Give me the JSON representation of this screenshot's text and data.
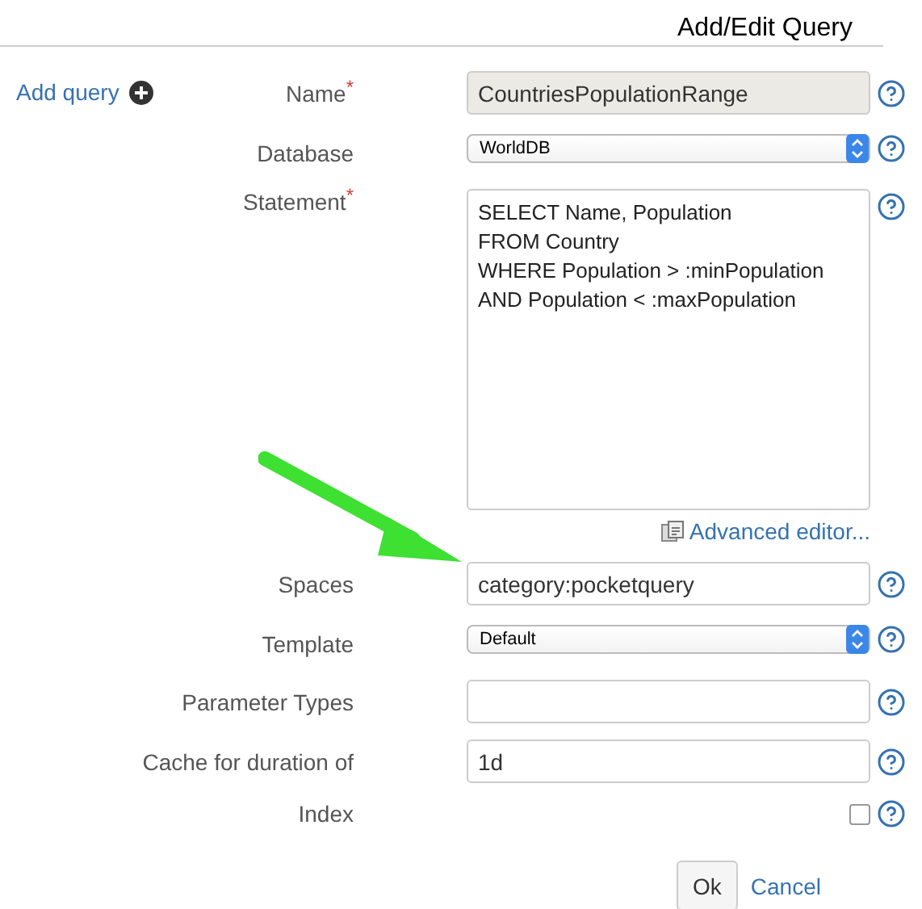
{
  "header": {
    "title": "Add/Edit Query"
  },
  "sidebar": {
    "add_link": "Add query"
  },
  "fields": [
    {
      "kind": "text",
      "label": "Name",
      "required_mark": "*",
      "value": "CountriesPopulationRange",
      "disabled": true
    },
    {
      "kind": "select",
      "label": "Database",
      "value": "WorldDB"
    },
    {
      "kind": "textarea",
      "label": "Statement",
      "required_mark": "*",
      "value": "SELECT Name, Population\nFROM Country\nWHERE Population > :minPopulation\nAND Population < :maxPopulation",
      "link": "Advanced editor..."
    },
    {
      "kind": "text",
      "label": "Spaces",
      "value": "category:pocketquery",
      "disabled": false
    },
    {
      "kind": "select",
      "label": "Template",
      "value": "Default"
    },
    {
      "kind": "text",
      "label": "Parameter Types",
      "disabled": false
    },
    {
      "kind": "text",
      "label": "Cache for duration of",
      "value": "1d",
      "disabled": false
    },
    {
      "kind": "checkbox",
      "label": "Index",
      "checked": false
    }
  ],
  "buttons": {
    "ok": "Ok",
    "cancel": "Cancel"
  }
}
